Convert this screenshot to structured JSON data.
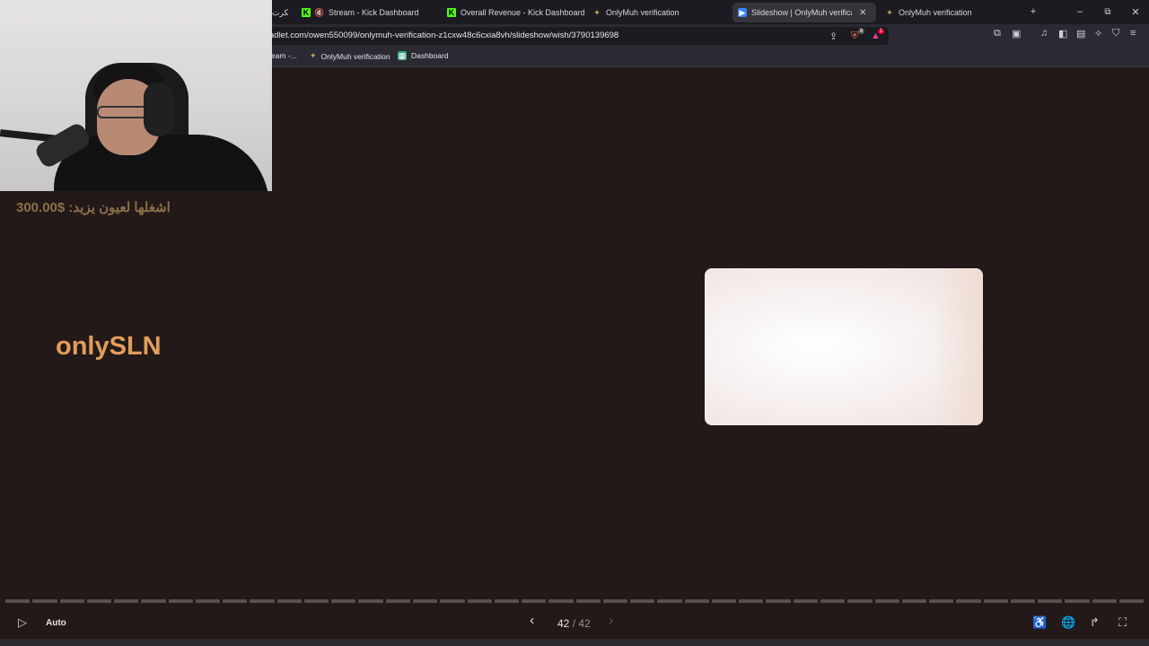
{
  "browser": {
    "tabs": [
      {
        "label": "الكرت",
        "icon": "tab-icon-partial",
        "active": false
      },
      {
        "label": "Stream - Kick Dashboard",
        "icon": "muted-speaker-icon",
        "active": false
      },
      {
        "label": "Overall Revenue - Kick Dashboard",
        "icon": "kick-logo-icon",
        "active": false
      },
      {
        "label": "OnlyMuh verification",
        "icon": "onlymuh-star-icon",
        "active": false
      },
      {
        "label": "Slideshow | OnlyMuh verificatio",
        "icon": "slideshow-icon",
        "active": true
      },
      {
        "label": "OnlyMuh verification",
        "icon": "onlymuh-star-icon",
        "active": false
      }
    ],
    "new_tab_symbol": "+",
    "window_controls": {
      "minimize": "–",
      "restore": "⧉",
      "close": "✕"
    },
    "url": "adlet.com/owen550099/onlymuh-verification-z1cxw48c6cxia8vh/slideshow/wish/3790139698",
    "shield_badge": "8",
    "alert_badge": "1",
    "bookmarks": [
      {
        "label": "eam -...",
        "icon": "bookmark-partial-icon"
      },
      {
        "label": "OnlyMuh verification",
        "icon": "onlymuh-star-icon"
      },
      {
        "label": "Dashboard",
        "icon": "dashboard-icon"
      }
    ]
  },
  "overlay": {
    "donation_text": "اشغلها لعيون يزيد: $300.00"
  },
  "slide": {
    "title": "onlySLN",
    "image": "blurred-white-image"
  },
  "player": {
    "mode_label": "Auto",
    "current": "42",
    "separator": "/",
    "total": "42",
    "segments": 42,
    "colors": {
      "background": "#231918",
      "title": "#e09d5b",
      "donation": "#8b6f49"
    }
  }
}
